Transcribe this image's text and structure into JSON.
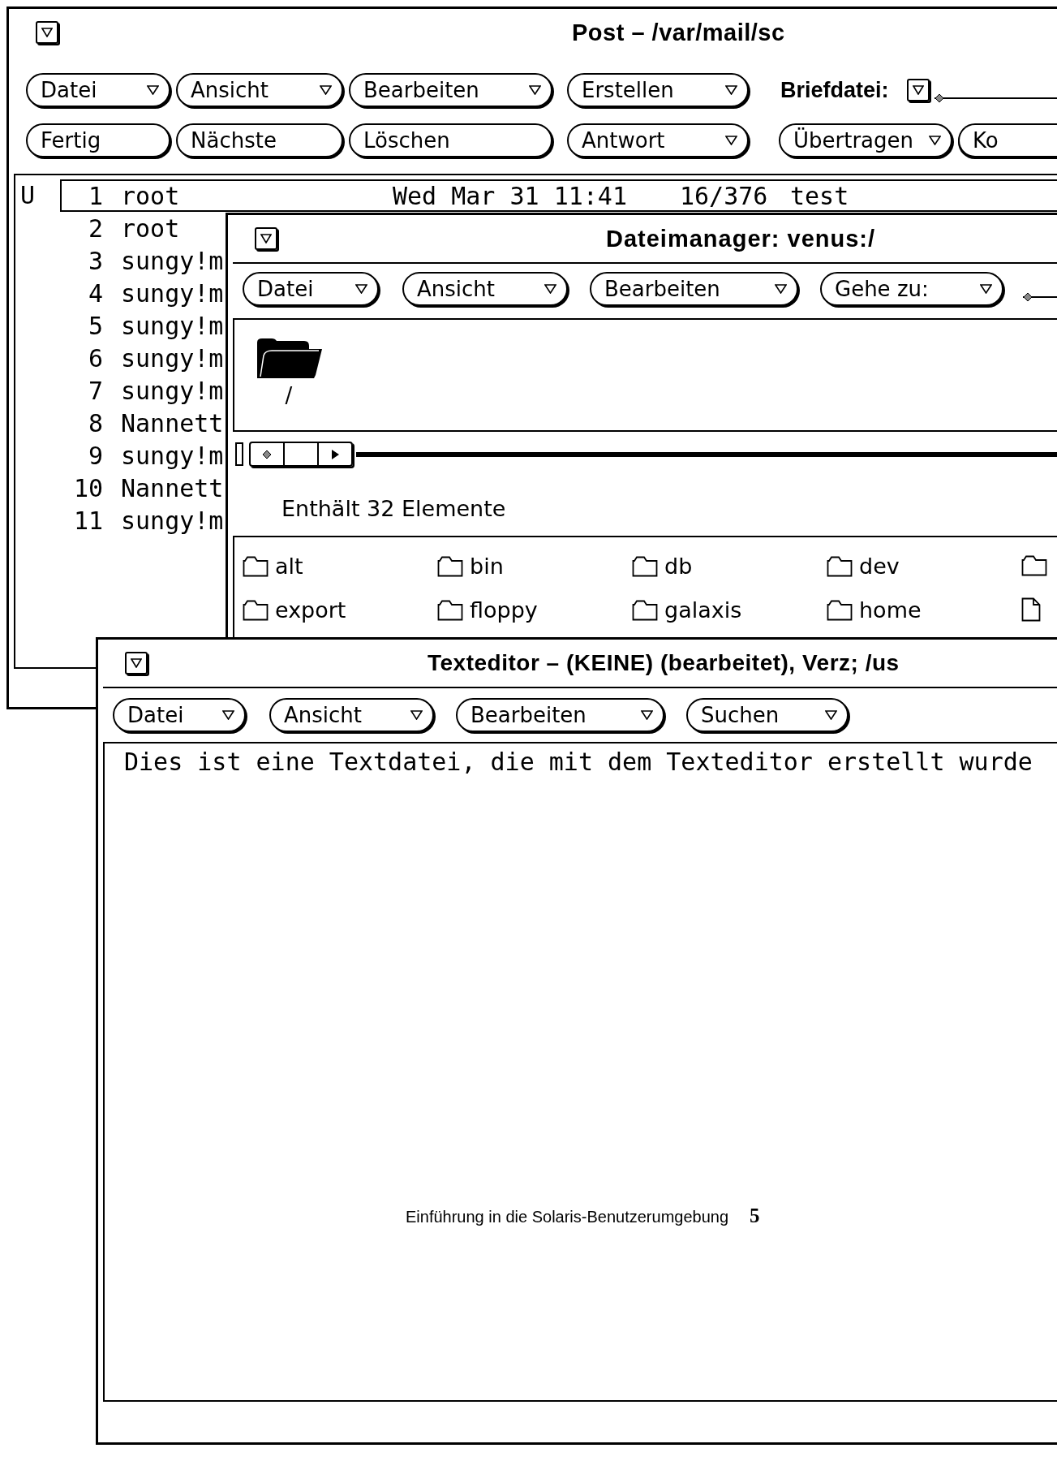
{
  "mail_window": {
    "title": "Post – /var/mail/sc",
    "menu_buttons": [
      {
        "label": "Datei",
        "menu": true
      },
      {
        "label": "Ansicht",
        "menu": true
      },
      {
        "label": "Bearbeiten",
        "menu": true
      },
      {
        "label": "Erstellen",
        "menu": true
      }
    ],
    "mail_file": {
      "label": "Briefdatei:"
    },
    "action_buttons": [
      {
        "label": "Fertig",
        "menu": false
      },
      {
        "label": "Nächste",
        "menu": false
      },
      {
        "label": "Löschen",
        "menu": false
      },
      {
        "label": "Antwort",
        "menu": true
      },
      {
        "label": "Übertragen",
        "menu": true
      },
      {
        "label": "Ko",
        "menu": false
      }
    ],
    "messages": [
      {
        "status": "U",
        "number": "1",
        "sender": "root",
        "date": "Wed Mar 31 11:41",
        "size": "16/376",
        "subject": "test",
        "selected": true
      },
      {
        "number": "2",
        "sender": "root",
        "selected": false
      },
      {
        "number": "3",
        "sender": "sungy!m",
        "selected": false
      },
      {
        "number": "4",
        "sender": "sungy!m",
        "selected": false
      },
      {
        "number": "5",
        "sender": "sungy!m",
        "selected": false
      },
      {
        "number": "6",
        "sender": "sungy!m",
        "selected": false
      },
      {
        "number": "7",
        "sender": "sungy!m",
        "selected": false
      },
      {
        "number": "8",
        "sender": "Nannett",
        "selected": false
      },
      {
        "number": "9",
        "sender": "sungy!m",
        "selected": false
      },
      {
        "number": "10",
        "sender": "Nannett",
        "selected": false
      },
      {
        "number": "11",
        "sender": "sungy!m",
        "selected": false
      }
    ]
  },
  "file_manager": {
    "title": "Dateimanager: venus:/",
    "menu_buttons": [
      {
        "label": "Datei",
        "menu": true
      },
      {
        "label": "Ansicht",
        "menu": true
      },
      {
        "label": "Bearbeiten",
        "menu": true
      },
      {
        "label": "Gehe zu:",
        "menu": true
      }
    ],
    "path": "/",
    "item_count": "Enthält 32 Elemente",
    "files": [
      {
        "name": "alt",
        "kind": "folder"
      },
      {
        "name": "bin",
        "kind": "folder"
      },
      {
        "name": "db",
        "kind": "folder"
      },
      {
        "name": "dev",
        "kind": "folder"
      },
      {
        "kind": "folder"
      },
      {
        "name": "export",
        "kind": "folder"
      },
      {
        "name": "floppy",
        "kind": "folder"
      },
      {
        "name": "galaxis",
        "kind": "folder"
      },
      {
        "name": "home",
        "kind": "folder"
      },
      {
        "kind": "document"
      }
    ]
  },
  "text_editor": {
    "title": "Texteditor – (KEINE) (bearbeitet), Verz; /us",
    "menu_buttons": [
      {
        "label": "Datei",
        "menu": true
      },
      {
        "label": "Ansicht",
        "menu": true
      },
      {
        "label": "Bearbeiten",
        "menu": true
      },
      {
        "label": "Suchen",
        "menu": true
      }
    ],
    "content": "Dies ist eine Textdatei, die mit dem Texteditor erstellt wurde"
  },
  "page_footer": {
    "title": "Einführung in die Solaris-Benutzerumgebung",
    "page_number": "5"
  }
}
